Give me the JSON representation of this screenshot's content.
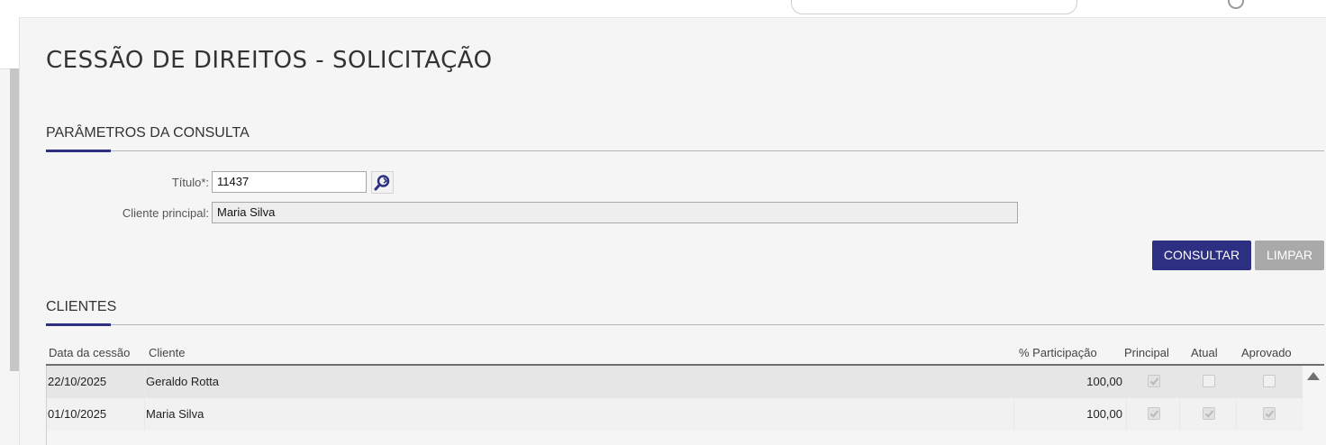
{
  "page": {
    "title": "CESSÃO DE DIREITOS - SOLICITAÇÃO"
  },
  "params": {
    "section_title": "PARÂMETROS DA CONSULTA",
    "titulo_label": "Título*:",
    "titulo_value": "11437",
    "cliente_label": "Cliente principal:",
    "cliente_value": "Maria Silva",
    "consultar_label": "CONSULTAR",
    "limpar_label": "LIMPAR"
  },
  "clientes": {
    "section_title": "CLIENTES",
    "columns": {
      "data": "Data da cessão",
      "cliente": "Cliente",
      "participacao": "% Participação",
      "principal": "Principal",
      "atual": "Atual",
      "aprovado": "Aprovado"
    },
    "rows": [
      {
        "data": "22/10/2025",
        "cliente": "Geraldo Rotta",
        "participacao": "100,00",
        "principal": true,
        "atual": false,
        "aprovado": false
      },
      {
        "data": "01/10/2025",
        "cliente": "Maria Silva",
        "participacao": "100,00",
        "principal": true,
        "atual": true,
        "aprovado": true
      }
    ]
  },
  "colors": {
    "accent": "#2d2f82",
    "limpar": "#a9a9a9"
  }
}
